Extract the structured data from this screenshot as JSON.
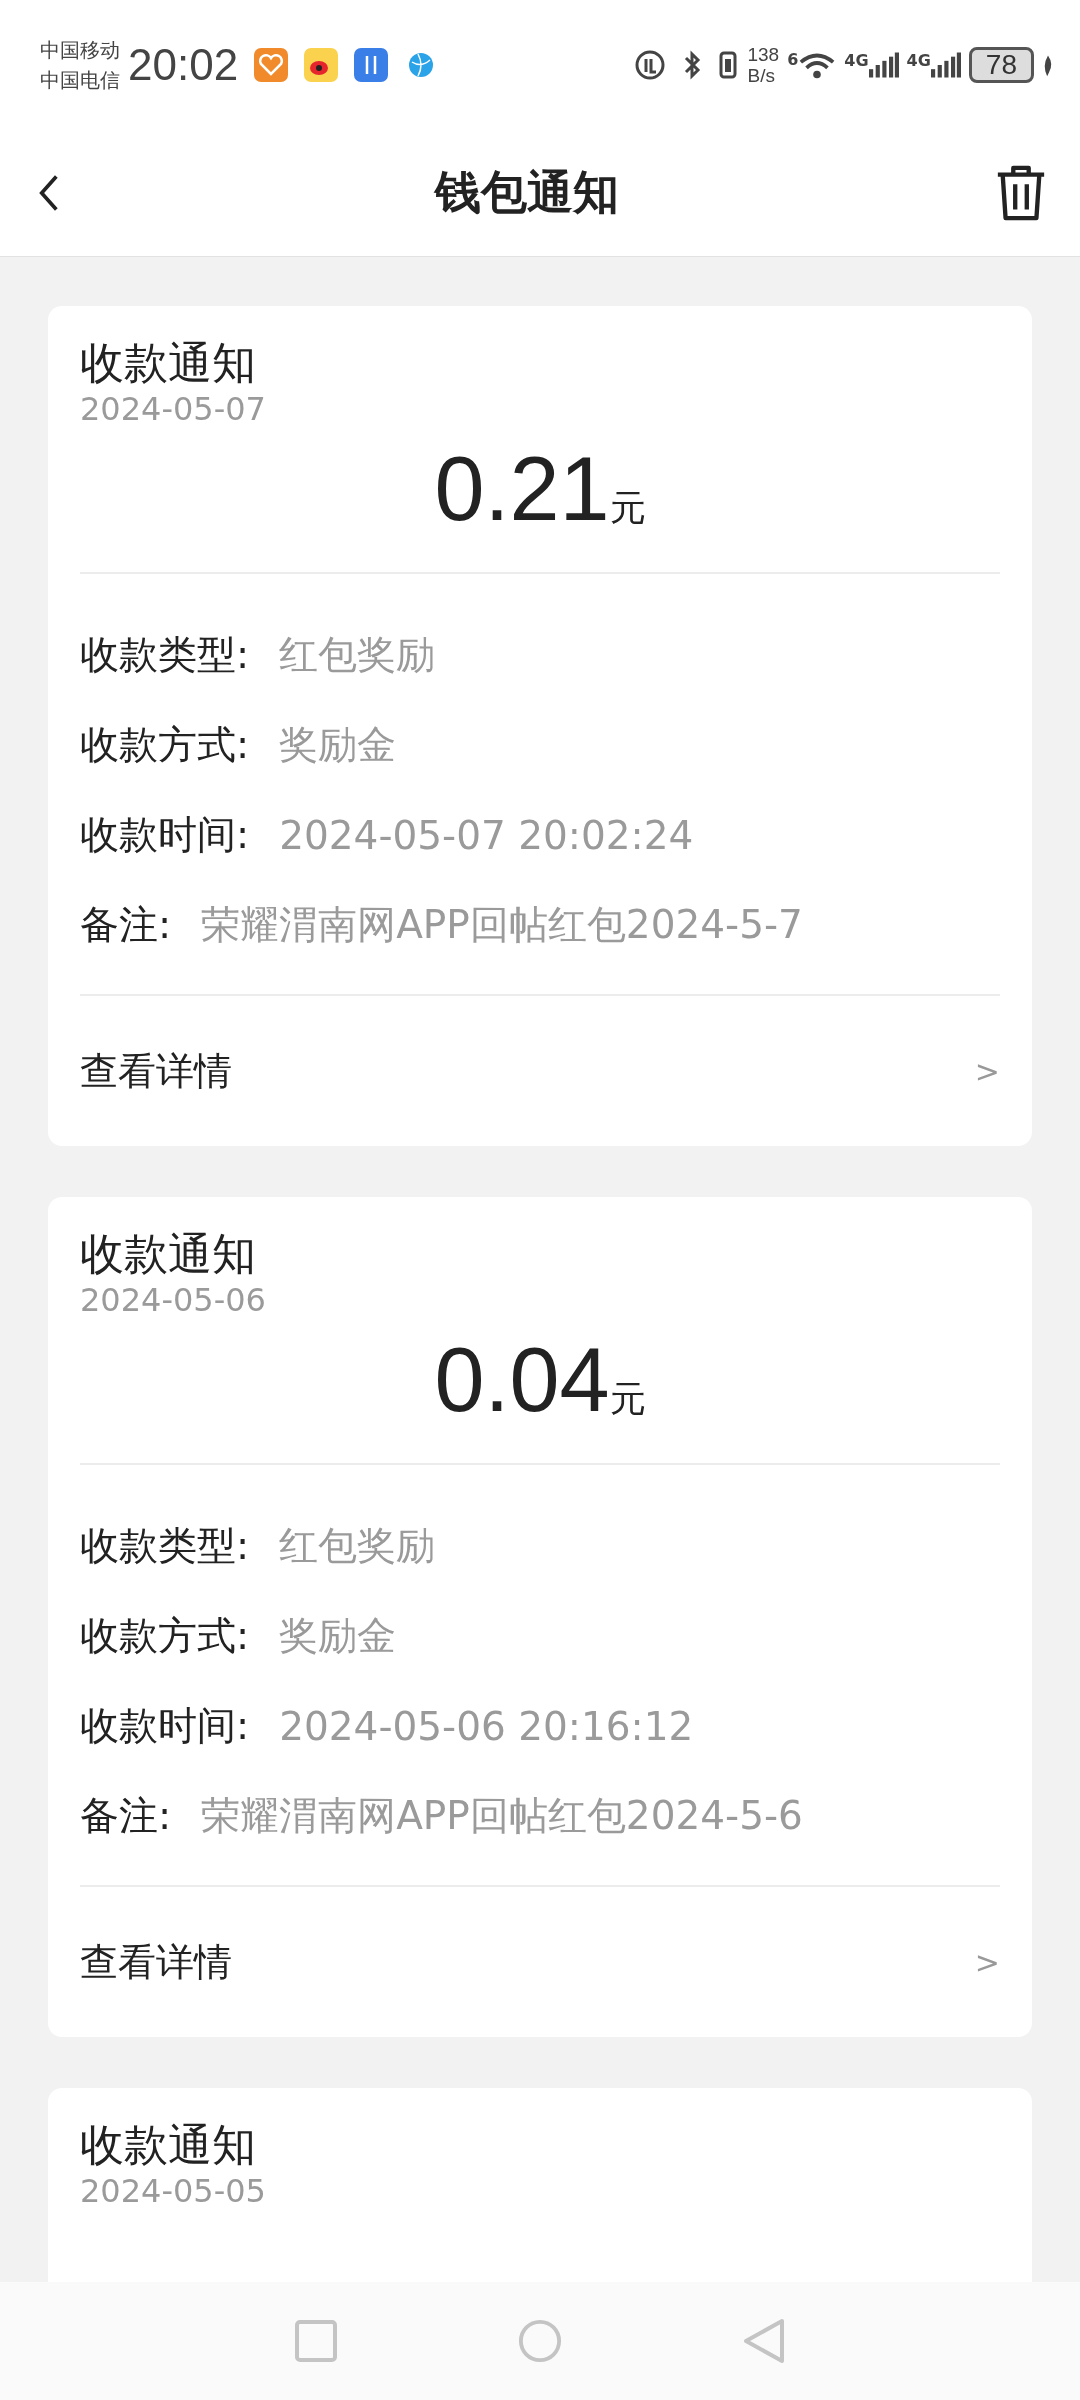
{
  "status_bar": {
    "carriers": [
      "中国移动",
      "中国电信"
    ],
    "time": "20:02",
    "net_speed": [
      "138",
      "B/s"
    ],
    "wifi_badge": "6",
    "signals": [
      "4G",
      "4G"
    ],
    "battery": "78"
  },
  "header": {
    "title": "钱包通知"
  },
  "notices": [
    {
      "title": "收款通知",
      "date": "2024-05-07",
      "amount": "0.21",
      "unit": "元",
      "fields": [
        {
          "label": "收款类型:",
          "value": "红包奖励"
        },
        {
          "label": "收款方式:",
          "value": "奖励金"
        },
        {
          "label": "收款时间:",
          "value": "2024-05-07 20:02:24"
        },
        {
          "label": "备注:",
          "value": "荣耀渭南网APP回帖红包2024-5-7"
        }
      ],
      "link": "查看详情",
      "chevron": ">"
    },
    {
      "title": "收款通知",
      "date": "2024-05-06",
      "amount": "0.04",
      "unit": "元",
      "fields": [
        {
          "label": "收款类型:",
          "value": "红包奖励"
        },
        {
          "label": "收款方式:",
          "value": "奖励金"
        },
        {
          "label": "收款时间:",
          "value": "2024-05-06 20:16:12"
        },
        {
          "label": "备注:",
          "value": "荣耀渭南网APP回帖红包2024-5-6"
        }
      ],
      "link": "查看详情",
      "chevron": ">"
    },
    {
      "title": "收款通知",
      "date": "2024-05-05"
    }
  ]
}
